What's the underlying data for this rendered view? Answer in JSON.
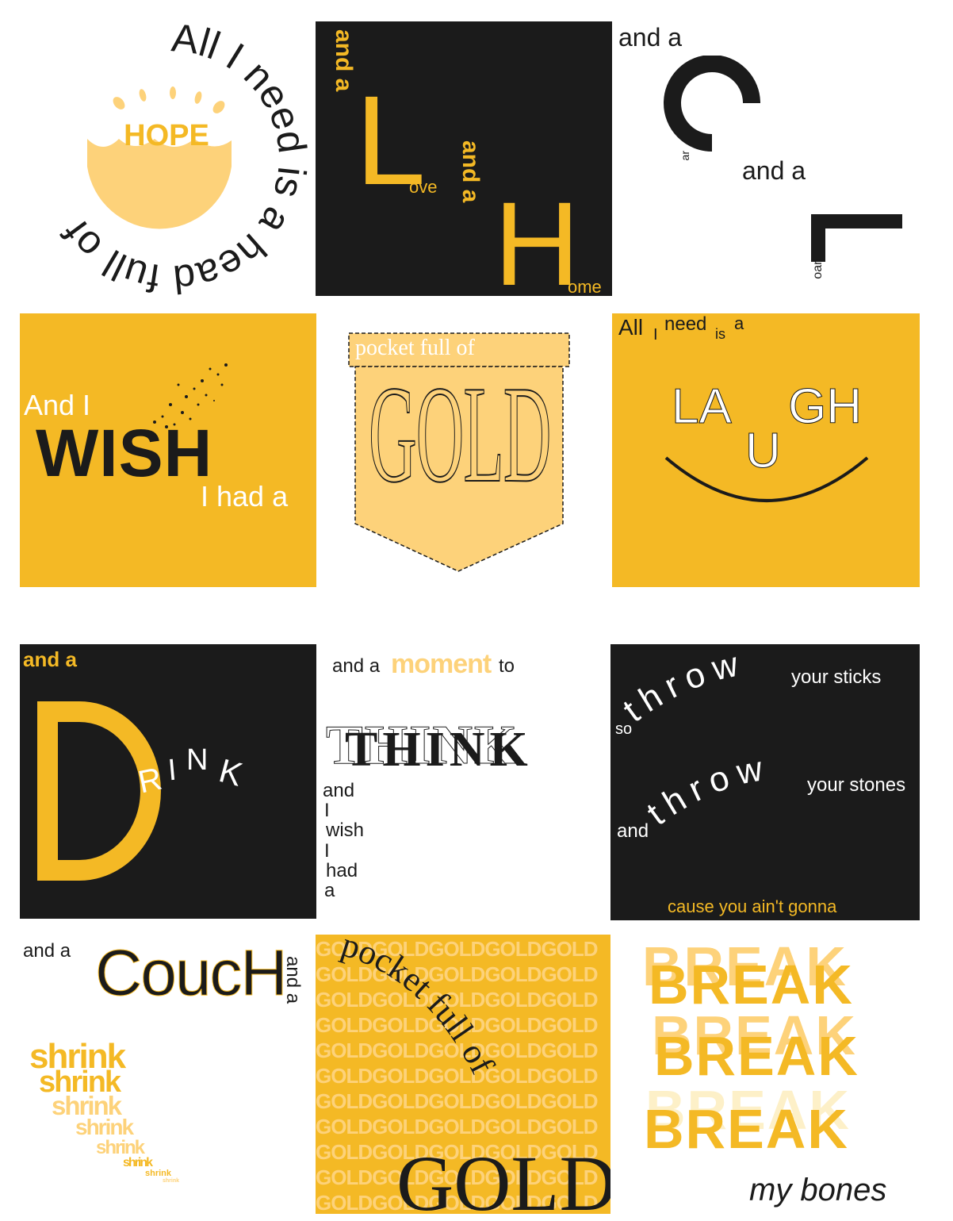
{
  "colors": {
    "gold": "#f4b925",
    "light_gold": "#fdd27a",
    "black": "#1b1b1b",
    "white": "#ffffff"
  },
  "t1": {
    "ring_text": "All I need is a head full of ",
    "hope": "HOPE"
  },
  "t2": {
    "and_a_1": "and a",
    "L": "L",
    "ove": "ove",
    "and_a_2": "and a",
    "H": "H",
    "ome": "ome"
  },
  "t3": {
    "and_a_1": "and a",
    "C": "C",
    "ar": "ar",
    "and_a_2": "and a",
    "L": "L",
    "oan": "oan"
  },
  "t4": {
    "and_i": "And I",
    "wish": "WISH",
    "i_had_a": "I had a"
  },
  "t5": {
    "pocket": "pocket full of",
    "gold": "GOLD"
  },
  "t6": {
    "all": "All",
    "i": "I",
    "need": "need",
    "is": "is",
    "a": "a",
    "la": "LA",
    "u": "U",
    "gh": "GH"
  },
  "t7": {
    "and_a": "and a",
    "D": "D",
    "R": "R",
    "I": "I",
    "N": "N",
    "K": "K"
  },
  "t8": {
    "and_a": "and a",
    "moment": "moment",
    "to": "to",
    "think": "THINK",
    "stack": [
      "and",
      "I",
      "wish",
      "I",
      "had",
      "a"
    ]
  },
  "t9": {
    "so": "so",
    "throw": "throw",
    "your_sticks": "your sticks",
    "and": "and",
    "your_stones": "your stones",
    "cause": "cause you ain't gonna"
  },
  "t10": {
    "and_a_1": "and a",
    "couch": "CoucH",
    "and_a_2": "and a",
    "shrink": "shrink"
  },
  "t11": {
    "gold_word": "GOLD",
    "pocket": "pocket full of",
    "gold": "GOLD"
  },
  "t12": {
    "break": "BREAK",
    "my_bones": "my bones"
  }
}
